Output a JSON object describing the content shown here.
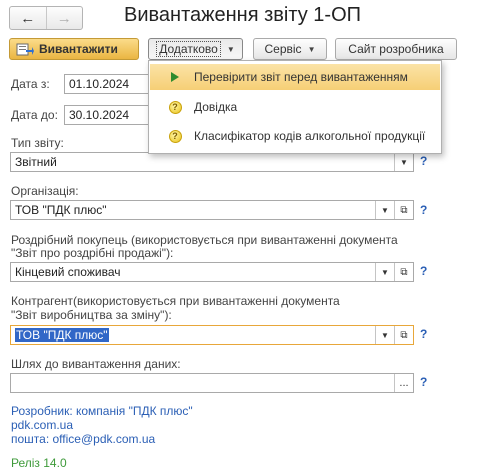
{
  "window": {
    "title": "Вивантаження звіту 1-ОП"
  },
  "nav": {
    "back_icon": "arrow-left-icon",
    "forward_icon": "arrow-right-icon"
  },
  "toolbar": {
    "upload_label": "Вивантажити",
    "more_label": "Додатково",
    "service_label": "Сервіс",
    "developer_site_label": "Сайт розробника"
  },
  "menu": {
    "items": [
      {
        "label": "Перевірити звіт перед вивантаженням",
        "icon": "play-icon"
      },
      {
        "label": "Довідка",
        "icon": "question-icon"
      },
      {
        "label": "Класифікатор кодів алкогольної продукції",
        "icon": "question-icon"
      }
    ]
  },
  "form": {
    "date_from_label": "Дата з:",
    "date_from_value": "01.10.2024",
    "date_to_label": "Дата до:",
    "date_to_value": "30.10.2024",
    "report_type_label": "Тип звіту:",
    "report_type_value": "Звітний",
    "organization_label": "Організація:",
    "organization_value": "ТОВ \"ПДК плюс\"",
    "retail_buyer_label_1": "Роздрібний покупець (використовується при вивантаженні документа",
    "retail_buyer_label_2": "\"Звіт про роздрібні продажі\"):",
    "retail_buyer_value": "Кінцевий споживач",
    "counterparty_label_1": "Контрагент(використовується при вивантаженні документа",
    "counterparty_label_2": "\"Звіт виробництва за зміну\"):",
    "counterparty_value": "ТОВ \"ПДК плюс\"",
    "path_label": "Шлях до вивантаження даних:",
    "path_value": "",
    "help_mark": "?",
    "select_button": "..."
  },
  "footer": {
    "developer": "Розробник: компанія \"ПДК плюс\"",
    "site": "pdk.com.ua",
    "email": "пошта: office@pdk.com.ua",
    "release": "Реліз 14.0"
  },
  "colors": {
    "accent_button": "#eab542",
    "link": "#2b5fb5",
    "release": "#3e9a3a",
    "menu_highlight": "#f6cf76",
    "selection": "#3167c7"
  }
}
